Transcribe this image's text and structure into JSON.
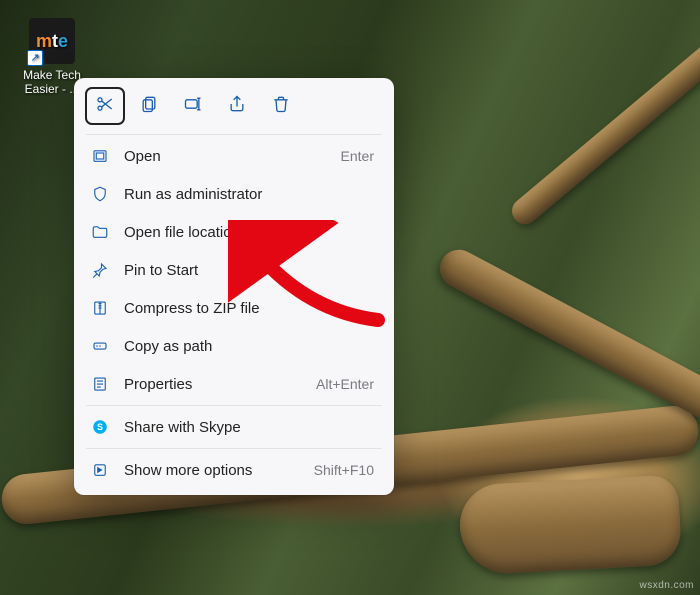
{
  "desktop_icon": {
    "label": "Make Tech Easier - ...",
    "logo": {
      "m": "m",
      "t": "t",
      "e": "e"
    }
  },
  "context_menu": {
    "top_actions": [
      {
        "name": "cut",
        "selected": true
      },
      {
        "name": "copy",
        "selected": false
      },
      {
        "name": "rename",
        "selected": false
      },
      {
        "name": "share",
        "selected": false
      },
      {
        "name": "delete",
        "selected": false
      }
    ],
    "items": [
      {
        "id": "open",
        "label": "Open",
        "accel": "Enter",
        "icon": "open-icon"
      },
      {
        "id": "run-admin",
        "label": "Run as administrator",
        "accel": "",
        "icon": "shield-icon"
      },
      {
        "id": "location",
        "label": "Open file location",
        "accel": "",
        "icon": "folder-icon"
      },
      {
        "id": "pin-start",
        "label": "Pin to Start",
        "accel": "",
        "icon": "pin-icon"
      },
      {
        "id": "zip",
        "label": "Compress to ZIP file",
        "accel": "",
        "icon": "zip-icon"
      },
      {
        "id": "copy-path",
        "label": "Copy as path",
        "accel": "",
        "icon": "path-icon"
      },
      {
        "id": "properties",
        "label": "Properties",
        "accel": "Alt+Enter",
        "icon": "properties-icon"
      },
      {
        "id": "skype",
        "label": "Share with Skype",
        "accel": "",
        "icon": "skype-icon"
      },
      {
        "id": "more",
        "label": "Show more options",
        "accel": "Shift+F10",
        "icon": "more-icon"
      }
    ]
  },
  "annotation": {
    "points_to": "pin-start"
  },
  "watermark": "wsxdn.com"
}
